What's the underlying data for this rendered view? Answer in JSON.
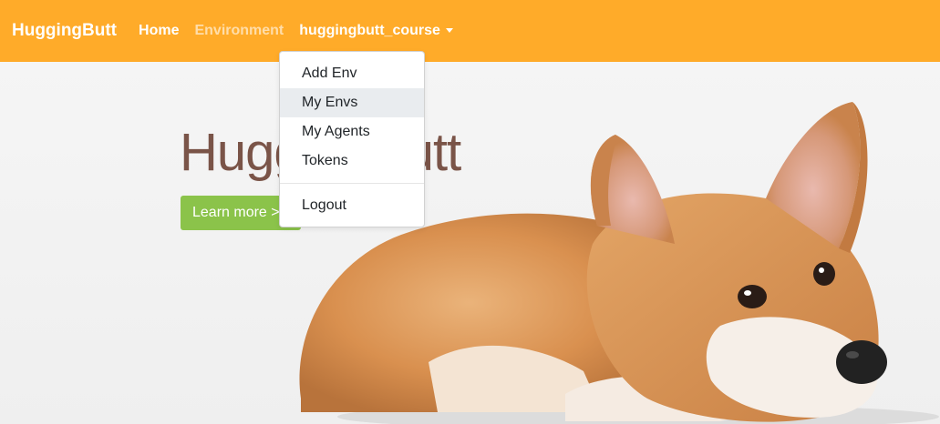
{
  "navbar": {
    "brand": "HuggingButt",
    "links": [
      {
        "label": "Home"
      },
      {
        "label": "Environment"
      }
    ],
    "user_menu_label": "huggingbutt_course"
  },
  "dropdown": {
    "items": [
      {
        "label": "Add Env"
      },
      {
        "label": "My Envs"
      },
      {
        "label": "My Agents"
      },
      {
        "label": "Tokens"
      }
    ],
    "logout_label": "Logout"
  },
  "hero": {
    "title": "HuggingButt",
    "button_label": "Learn more >"
  },
  "colors": {
    "navbar": "#ffab29",
    "button": "#8bc34a",
    "title": "#7a5448"
  }
}
